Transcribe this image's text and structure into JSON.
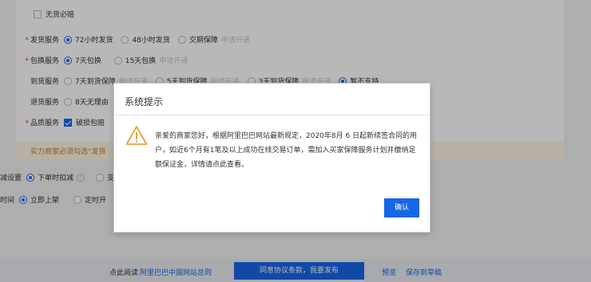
{
  "form": {
    "no_shortage_label": "无货必赔",
    "shipping": {
      "label": "发货服务",
      "options": [
        "72小时发货",
        "48小时发货",
        "交期保障"
      ],
      "hint": "申请开通"
    },
    "exchange": {
      "label": "包换服务",
      "options": [
        "7天包换",
        "15天包换"
      ],
      "hint": "申请开通"
    },
    "arrival": {
      "label": "到货服务",
      "options": [
        "7天到货保障",
        "5天到货保障",
        "3天到货保障",
        "暂不支持"
      ],
      "hint": "申请开通"
    },
    "return": {
      "label": "退货服务",
      "options": [
        "8天无理由"
      ]
    },
    "quality": {
      "label": "品质服务",
      "option": "破损包赔"
    },
    "notice": "实力商家必须勾选“发货",
    "inventory": {
      "label": "减设置",
      "options": [
        "下单时扣减",
        "支"
      ]
    },
    "time": {
      "label": "时间",
      "options": [
        "立即上架",
        "定时开"
      ]
    }
  },
  "footer": {
    "read_label": "点此阅读",
    "rules_link": "阿里巴巴中国网站总则",
    "agree_button": "同意协议条款，我要发布",
    "preview": "预览",
    "save_draft": "保存到草稿"
  },
  "dialog": {
    "title": "系统提示",
    "message": "亲爱的商家您好，根据阿里巴巴网站最新规定，2020年8月 6 日起新续签合同的用户，如近6个月有1笔及以上成功在线交易订单，需加入买家保障服务计划并缴纳足额保证金，详情请点此查看。",
    "confirm": "确认",
    "icon": "warning-icon"
  },
  "colors": {
    "primary": "#1766e8",
    "required": "#e4393c",
    "warning": "#e8a23a"
  }
}
